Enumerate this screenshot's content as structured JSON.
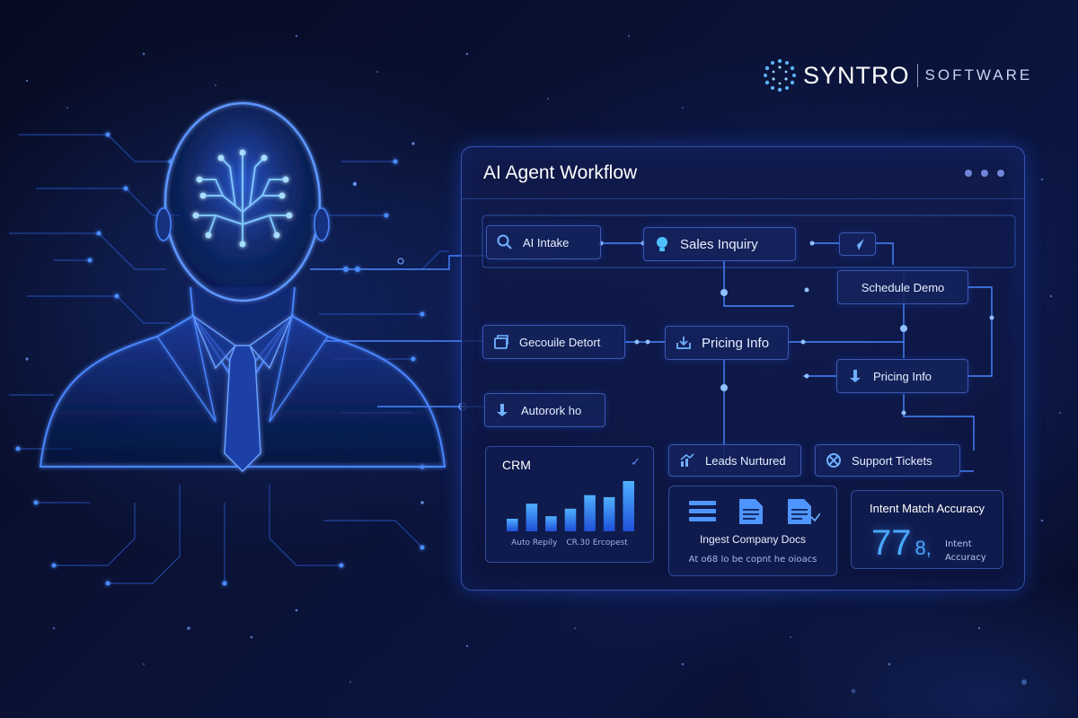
{
  "brand": {
    "name": "SYNTRO",
    "subtitle": "SOFTWARE"
  },
  "panel": {
    "title": "AI Agent Workflow"
  },
  "nodes": {
    "ai_intake": "AI Intake",
    "sales_inquiry": "Sales Inquiry",
    "schedule_demo": "Schedule Demo",
    "geocoule_detort": "Gecouile Detort",
    "pricing_info_center": "Pricing Info",
    "pricing_info_right": "Pricing Info",
    "autorork": "Autorork ho",
    "leads_nurtured": "Leads Nurtured",
    "support_tickets": "Support Tickets"
  },
  "crm": {
    "title": "CRM",
    "footer_left": "Auto Repily",
    "footer_right": "CR.30 Ercopest",
    "bar_levels": [
      0.25,
      0.55,
      0.3,
      0.45,
      0.72,
      0.68,
      1.0
    ]
  },
  "docs": {
    "title": "Ingest Company Docs",
    "subtitle": "At o68 Io be copnt he oioacs"
  },
  "accuracy": {
    "title": "Intent Match Accuracy",
    "value": "77",
    "value_suffix": "8,",
    "label_line1": "Intent",
    "label_line2": "Accuracy"
  },
  "colors": {
    "background": "#0a1236",
    "accent": "#3d7bff",
    "glow": "#4aa8ff",
    "node_fill": "#14225c",
    "node_border": "#5f87ff"
  }
}
